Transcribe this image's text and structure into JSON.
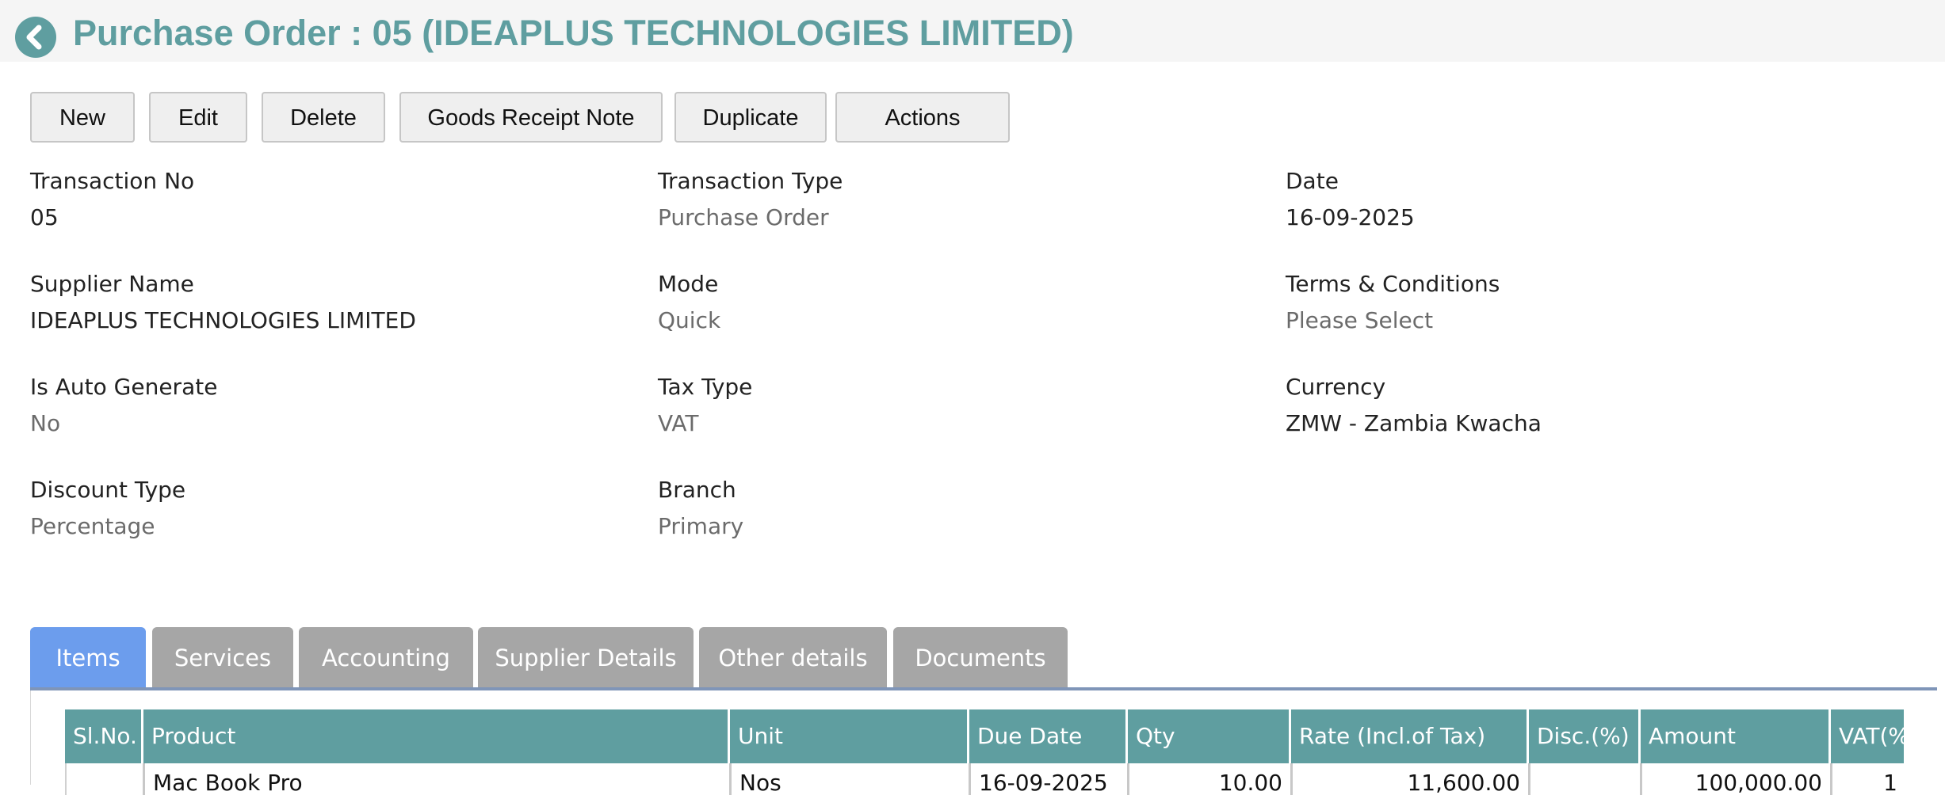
{
  "header": {
    "title": "Purchase Order : 05 (IDEAPLUS TECHNOLOGIES LIMITED)",
    "back_icon": "chevron-left-icon",
    "accent_color": "#5f9ea0"
  },
  "toolbar": {
    "new_label": "New",
    "edit_label": "Edit",
    "delete_label": "Delete",
    "grn_label": "Goods Receipt Note",
    "duplicate_label": "Duplicate",
    "actions_label": "Actions"
  },
  "details": {
    "transaction_no": {
      "label": "Transaction No",
      "value": "05"
    },
    "transaction_type": {
      "label": "Transaction Type",
      "value": "Purchase Order"
    },
    "date": {
      "label": "Date",
      "value": "16-09-2025"
    },
    "supplier_name": {
      "label": "Supplier Name",
      "value": "IDEAPLUS TECHNOLOGIES LIMITED"
    },
    "mode": {
      "label": "Mode",
      "value": "Quick"
    },
    "terms": {
      "label": "Terms & Conditions",
      "value": "Please Select"
    },
    "is_auto_generate": {
      "label": "Is Auto Generate",
      "value": "No"
    },
    "tax_type": {
      "label": "Tax Type",
      "value": "VAT"
    },
    "currency": {
      "label": "Currency",
      "value": "ZMW - Zambia Kwacha"
    },
    "discount_type": {
      "label": "Discount Type",
      "value": "Percentage"
    },
    "branch": {
      "label": "Branch",
      "value": "Primary"
    }
  },
  "tabs": {
    "items": "Items",
    "services": "Services",
    "accounting": "Accounting",
    "supplier_details": "Supplier Details",
    "other_details": "Other details",
    "documents": "Documents",
    "active": "Items",
    "active_color": "#6c9ded"
  },
  "items_table": {
    "headers": {
      "slno": "Sl.No.",
      "product": "Product",
      "unit": "Unit",
      "due_date": "Due Date",
      "qty": "Qty",
      "rate": "Rate (Incl.of Tax)",
      "disc": "Disc.(%)",
      "amount": "Amount",
      "vat": "VAT(%)"
    },
    "rows": [
      {
        "slno": "",
        "product": "Mac Book Pro",
        "unit": "Nos",
        "due_date": "16-09-2025",
        "qty": "10.00",
        "rate": "11,600.00",
        "disc": "",
        "amount": "100,000.00",
        "vat": "1"
      }
    ]
  }
}
